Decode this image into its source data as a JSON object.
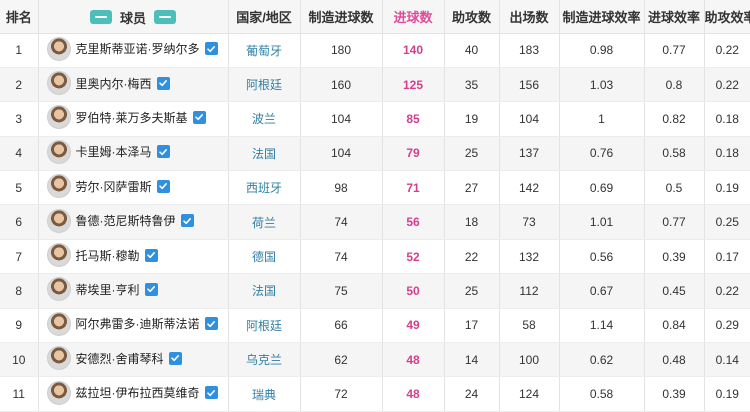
{
  "headers": {
    "rank": "排名",
    "player": "球员",
    "country": "国家/地区",
    "xg": "制造进球数",
    "goals": "进球数",
    "assists": "助攻数",
    "apps": "出场数",
    "xg_rate": "制造进球效率",
    "goal_rate": "进球效率",
    "assist_rate": "助攻效率"
  },
  "colors": {
    "goals": "#d43f8d",
    "country": "#2f7fa4",
    "checkbox": "#2f8fe0",
    "tag": "#4cc0b8"
  },
  "rows": [
    {
      "rank": "1",
      "player": "克里斯蒂亚诺·罗纳尔多",
      "country": "葡萄牙",
      "xg": "180",
      "goals": "140",
      "assists": "40",
      "apps": "183",
      "xg_rate": "0.98",
      "goal_rate": "0.77",
      "assist_rate": "0.22"
    },
    {
      "rank": "2",
      "player": "里奥内尔·梅西",
      "country": "阿根廷",
      "xg": "160",
      "goals": "125",
      "assists": "35",
      "apps": "156",
      "xg_rate": "1.03",
      "goal_rate": "0.8",
      "assist_rate": "0.22"
    },
    {
      "rank": "3",
      "player": "罗伯特·莱万多夫斯基",
      "country": "波兰",
      "xg": "104",
      "goals": "85",
      "assists": "19",
      "apps": "104",
      "xg_rate": "1",
      "goal_rate": "0.82",
      "assist_rate": "0.18"
    },
    {
      "rank": "4",
      "player": "卡里姆·本泽马",
      "country": "法国",
      "xg": "104",
      "goals": "79",
      "assists": "25",
      "apps": "137",
      "xg_rate": "0.76",
      "goal_rate": "0.58",
      "assist_rate": "0.18"
    },
    {
      "rank": "5",
      "player": "劳尔·冈萨雷斯",
      "country": "西班牙",
      "xg": "98",
      "goals": "71",
      "assists": "27",
      "apps": "142",
      "xg_rate": "0.69",
      "goal_rate": "0.5",
      "assist_rate": "0.19"
    },
    {
      "rank": "6",
      "player": "鲁德·范尼斯特鲁伊",
      "country": "荷兰",
      "xg": "74",
      "goals": "56",
      "assists": "18",
      "apps": "73",
      "xg_rate": "1.01",
      "goal_rate": "0.77",
      "assist_rate": "0.25"
    },
    {
      "rank": "7",
      "player": "托马斯·穆勒",
      "country": "德国",
      "xg": "74",
      "goals": "52",
      "assists": "22",
      "apps": "132",
      "xg_rate": "0.56",
      "goal_rate": "0.39",
      "assist_rate": "0.17"
    },
    {
      "rank": "8",
      "player": "蒂埃里·亨利",
      "country": "法国",
      "xg": "75",
      "goals": "50",
      "assists": "25",
      "apps": "112",
      "xg_rate": "0.67",
      "goal_rate": "0.45",
      "assist_rate": "0.22"
    },
    {
      "rank": "9",
      "player": "阿尔弗雷多·迪斯蒂法诺",
      "country": "阿根廷",
      "xg": "66",
      "goals": "49",
      "assists": "17",
      "apps": "58",
      "xg_rate": "1.14",
      "goal_rate": "0.84",
      "assist_rate": "0.29"
    },
    {
      "rank": "10",
      "player": "安德烈·舍甫琴科",
      "country": "乌克兰",
      "xg": "62",
      "goals": "48",
      "assists": "14",
      "apps": "100",
      "xg_rate": "0.62",
      "goal_rate": "0.48",
      "assist_rate": "0.14"
    },
    {
      "rank": "11",
      "player": "兹拉坦·伊布拉西莫维奇",
      "country": "瑞典",
      "xg": "72",
      "goals": "48",
      "assists": "24",
      "apps": "124",
      "xg_rate": "0.58",
      "goal_rate": "0.39",
      "assist_rate": "0.19"
    }
  ]
}
